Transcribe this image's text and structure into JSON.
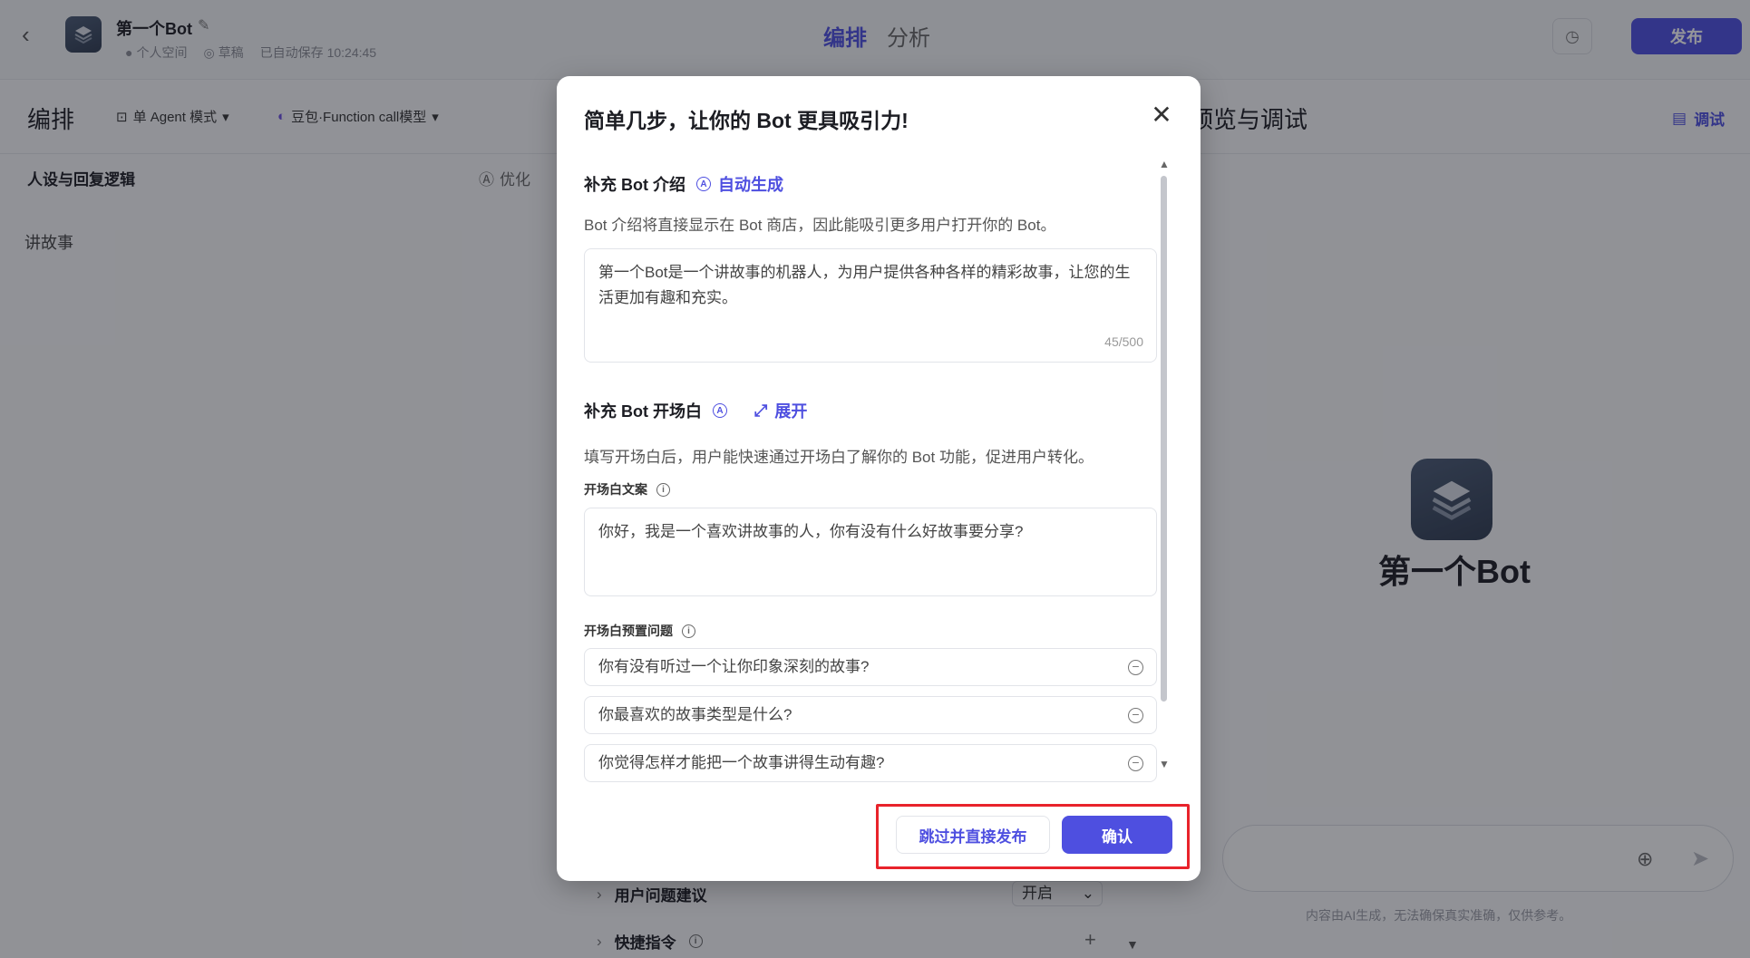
{
  "app": {
    "bot_name": "第一个Bot",
    "meta": {
      "space": "个人空间",
      "status": "草稿",
      "autosave": "已自动保存 10:24:45"
    },
    "tabs": [
      "编排",
      "分析"
    ],
    "publish_label": "发布"
  },
  "subbar": {
    "title": "编排",
    "mode": "单 Agent 模式",
    "model": "豆包·Function call模型",
    "preview_title": "预览与调试",
    "debug_label": "调试"
  },
  "left_panel": {
    "persona_title": "人设与回复逻辑",
    "optimize_label": "优化",
    "persona_text": "讲故事"
  },
  "mid_panel": {
    "suggestions_label": "用户问题建议",
    "suggestions_value": "开启",
    "shortcuts_label": "快捷指令"
  },
  "preview": {
    "bot_name": "第一个Bot",
    "disclaimer": "内容由AI生成，无法确保真实准确，仅供参考。"
  },
  "modal": {
    "title": "简单几步，让你的 Bot 更具吸引力!",
    "intro": {
      "heading": "补充 Bot 介绍",
      "auto_generate": "自动生成",
      "description": "Bot 介绍将直接显示在 Bot 商店，因此能吸引更多用户打开你的 Bot。",
      "value": "第一个Bot是一个讲故事的机器人，为用户提供各种各样的精彩故事，让您的生活更加有趣和充实。",
      "counter": "45/500"
    },
    "opening": {
      "heading": "补充 Bot 开场白",
      "expand": "展开",
      "description": "填写开场白后，用户能快速通过开场白了解你的 Bot 功能，促进用户转化。",
      "copy_label": "开场白文案",
      "copy_value": "你好，我是一个喜欢讲故事的人，你有没有什么好故事要分享?",
      "questions_label": "开场白预置问题",
      "questions": [
        "你有没有听过一个让你印象深刻的故事?",
        "你最喜欢的故事类型是什么?",
        "你觉得怎样才能把一个故事讲得生动有趣?"
      ]
    },
    "skip_label": "跳过并直接发布",
    "confirm_label": "确认"
  },
  "colors": {
    "accent": "#4e4fe0",
    "highlight_border": "#e8232b"
  }
}
